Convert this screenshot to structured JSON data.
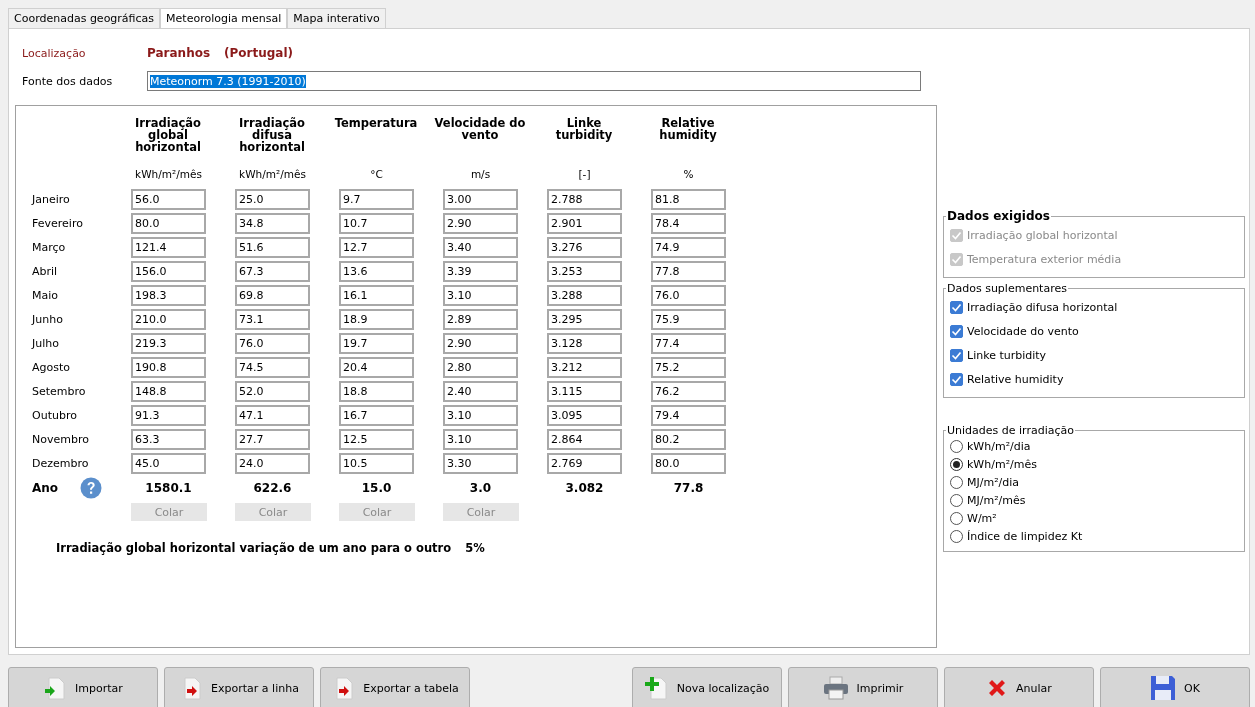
{
  "tabs": [
    {
      "label": "Coordenadas geográficas",
      "selected": false
    },
    {
      "label": "Meteorologia mensal",
      "selected": true
    },
    {
      "label": "Mapa interativo",
      "selected": false
    }
  ],
  "location": {
    "label": "Localização",
    "name": "Paranhos",
    "country": "(Portugal)"
  },
  "source": {
    "label": "Fonte dos dados",
    "value": "Meteonorm 7.3 (1991-2010)",
    "highlighted": true
  },
  "table": {
    "columns": [
      {
        "heading": "Irradiação global horizontal",
        "unit": "kWh/m²/mês",
        "total": "1580.1",
        "paste": {
          "label": "Colar",
          "disabled": true
        }
      },
      {
        "heading": "Irradiação difusa horizontal",
        "unit": "kWh/m²/mês",
        "total": "622.6",
        "paste": {
          "label": "Colar",
          "disabled": true
        }
      },
      {
        "heading": "Temperatura",
        "unit": "°C",
        "total": "15.0",
        "paste": {
          "label": "Colar",
          "disabled": true
        }
      },
      {
        "heading": "Velocidade do vento",
        "unit": "m/s",
        "total": "3.0",
        "paste": {
          "label": "Colar",
          "disabled": true
        }
      },
      {
        "heading": "Linke turbidity",
        "unit": "[-]",
        "total": "3.082"
      },
      {
        "heading": "Relative humidity",
        "unit": "%",
        "total": "77.8"
      }
    ],
    "rows": [
      {
        "month": "Janeiro",
        "values": [
          "56.0",
          "25.0",
          "9.7",
          "3.00",
          "2.788",
          "81.8"
        ]
      },
      {
        "month": "Fevereiro",
        "values": [
          "80.0",
          "34.8",
          "10.7",
          "2.90",
          "2.901",
          "78.4"
        ]
      },
      {
        "month": "Março",
        "values": [
          "121.4",
          "51.6",
          "12.7",
          "3.40",
          "3.276",
          "74.9"
        ]
      },
      {
        "month": "Abril",
        "values": [
          "156.0",
          "67.3",
          "13.6",
          "3.39",
          "3.253",
          "77.8"
        ]
      },
      {
        "month": "Maio",
        "values": [
          "198.3",
          "69.8",
          "16.1",
          "3.10",
          "3.288",
          "76.0"
        ]
      },
      {
        "month": "Junho",
        "values": [
          "210.0",
          "73.1",
          "18.9",
          "2.89",
          "3.295",
          "75.9"
        ]
      },
      {
        "month": "Julho",
        "values": [
          "219.3",
          "76.0",
          "19.7",
          "2.90",
          "3.128",
          "77.4"
        ]
      },
      {
        "month": "Agosto",
        "values": [
          "190.8",
          "74.5",
          "20.4",
          "2.80",
          "3.212",
          "75.2"
        ]
      },
      {
        "month": "Setembro",
        "values": [
          "148.8",
          "52.0",
          "18.8",
          "2.40",
          "3.115",
          "76.2"
        ]
      },
      {
        "month": "Outubro",
        "values": [
          "91.3",
          "47.1",
          "16.7",
          "3.10",
          "3.095",
          "79.4"
        ]
      },
      {
        "month": "Novembro",
        "values": [
          "63.3",
          "27.7",
          "12.5",
          "3.10",
          "2.864",
          "80.2"
        ]
      },
      {
        "month": "Dezembro",
        "values": [
          "45.0",
          "24.0",
          "10.5",
          "3.30",
          "2.769",
          "80.0"
        ]
      }
    ],
    "total_label": "Ano"
  },
  "variation": {
    "label": "Irradiação global horizontal variação de um ano para o outro",
    "value": "5%"
  },
  "required": {
    "title": "Dados exigidos",
    "items": [
      {
        "label": "Irradiação global horizontal",
        "checked": true,
        "disabled": true
      },
      {
        "label": "Temperatura exterior média",
        "checked": true,
        "disabled": true
      }
    ]
  },
  "supplementary": {
    "title": "Dados suplementares",
    "items": [
      {
        "label": "Irradiação difusa horizontal",
        "checked": true,
        "disabled": false
      },
      {
        "label": "Velocidade do vento",
        "checked": true,
        "disabled": false
      },
      {
        "label": "Linke turbidity",
        "checked": true,
        "disabled": false
      },
      {
        "label": "Relative humidity",
        "checked": true,
        "disabled": false
      }
    ]
  },
  "units": {
    "title": "Unidades de irradiação",
    "options": [
      {
        "label": "kWh/m²/dia",
        "selected": false
      },
      {
        "label": "kWh/m²/mês",
        "selected": true
      },
      {
        "label": "MJ/m²/dia",
        "selected": false
      },
      {
        "label": "MJ/m²/mês",
        "selected": false
      },
      {
        "label": "W/m²",
        "selected": false
      },
      {
        "label": "Índice de limpidez Kt",
        "selected": false
      }
    ]
  },
  "buttons": [
    {
      "label": "Importar",
      "kind": "import"
    },
    {
      "label": "Exportar a linha",
      "kind": "export"
    },
    {
      "label": "Exportar a tabela",
      "kind": "export"
    },
    {
      "label": "Nova localização",
      "kind": "new"
    },
    {
      "label": "Imprimir",
      "kind": "print"
    },
    {
      "label": "Anular",
      "kind": "cancel"
    },
    {
      "label": "OK",
      "kind": "save"
    }
  ]
}
